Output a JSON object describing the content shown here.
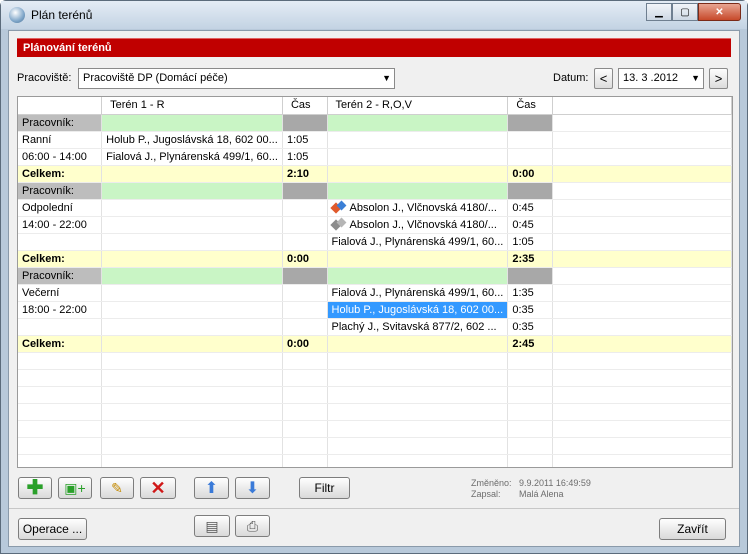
{
  "window": {
    "title": "Plán terénů"
  },
  "header": {
    "banner": "Plánování terénů"
  },
  "filters": {
    "pracoviste_label": "Pracoviště:",
    "pracoviste_value": "Pracoviště DP (Domácí péče)",
    "datum_label": "Datum:",
    "datum_value": "13. 3 .2012",
    "prev": "<",
    "next": ">"
  },
  "table": {
    "columns": [
      "",
      "Terén 1 - R",
      "Čas",
      "Terén 2 - R,O,V",
      "Čas"
    ],
    "rows": [
      {
        "type": "group",
        "c": [
          "Pracovník:",
          "",
          "",
          "",
          ""
        ]
      },
      {
        "c": [
          "Ranní",
          "Holub P., Jugoslávská 18, 602 00...",
          "1:05",
          "",
          ""
        ]
      },
      {
        "c": [
          "06:00 - 14:00",
          "Fialová J., Plynárenská 499/1, 60...",
          "1:05",
          "",
          ""
        ]
      },
      {
        "type": "total",
        "c": [
          "Celkem:",
          "",
          "2:10",
          "",
          "0:00"
        ]
      },
      {
        "type": "group",
        "c": [
          "Pracovník:",
          "",
          "",
          "",
          ""
        ]
      },
      {
        "c": [
          "Odpolední",
          "",
          "",
          "Absolon J., Vlčnovská 4180/...",
          "0:45"
        ],
        "icon": "color"
      },
      {
        "c": [
          "14:00 - 22:00",
          "",
          "",
          "Absolon J., Vlčnovská 4180/...",
          "0:45"
        ],
        "icon": "gray"
      },
      {
        "c": [
          "",
          "",
          "",
          "Fialová J., Plynárenská 499/1, 60...",
          "1:05"
        ]
      },
      {
        "type": "total",
        "c": [
          "Celkem:",
          "",
          "0:00",
          "",
          "2:35"
        ]
      },
      {
        "type": "group",
        "c": [
          "Pracovník:",
          "",
          "",
          "",
          ""
        ]
      },
      {
        "c": [
          "Večerní",
          "",
          "",
          "Fialová J., Plynárenská 499/1, 60...",
          "1:35"
        ]
      },
      {
        "c": [
          "18:00 - 22:00",
          "",
          "",
          "Holub P., Jugoslávská 18, 602 00...",
          "0:35"
        ],
        "selected": true
      },
      {
        "c": [
          "",
          "",
          "",
          "Plachý J., Svitavská 877/2, 602 ...",
          "0:35"
        ]
      },
      {
        "type": "total",
        "c": [
          "Celkem:",
          "",
          "0:00",
          "",
          "2:45"
        ]
      },
      {
        "c": [
          "",
          "",
          "",
          "",
          ""
        ]
      },
      {
        "c": [
          "",
          "",
          "",
          "",
          ""
        ]
      },
      {
        "c": [
          "",
          "",
          "",
          "",
          ""
        ]
      },
      {
        "c": [
          "",
          "",
          "",
          "",
          ""
        ]
      },
      {
        "c": [
          "",
          "",
          "",
          "",
          ""
        ]
      },
      {
        "c": [
          "",
          "",
          "",
          "",
          ""
        ]
      },
      {
        "c": [
          "",
          "",
          "",
          "",
          ""
        ]
      }
    ]
  },
  "toolbar": {
    "filter_label": "Filtr"
  },
  "meta": {
    "changed_label": "Změněno:",
    "changed_value": "9.9.2011 16:49:59",
    "logged_label": "Zapsal:",
    "logged_value": "Malá Alena"
  },
  "footer": {
    "operations_label": "Operace ...",
    "close_label": "Zavřít"
  },
  "colors": {
    "banner": "#c00000",
    "group_gray": "#bdbdbd",
    "group_green": "#c9f5c5",
    "total_yellow": "#ffffcc",
    "selection": "#3399ff"
  }
}
